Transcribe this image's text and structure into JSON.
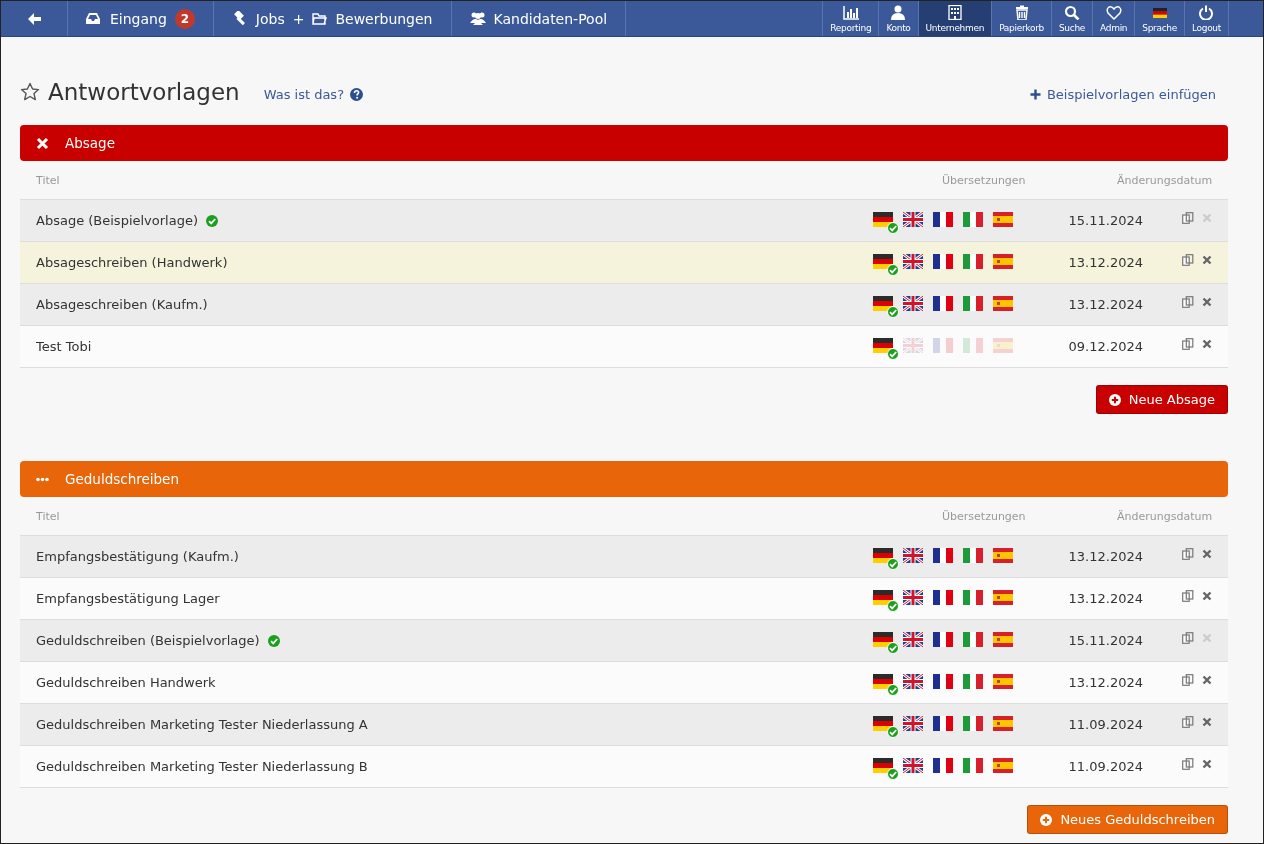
{
  "nav": {
    "left": [
      {
        "kind": "back"
      },
      {
        "kind": "link",
        "label": "Eingang",
        "badge": "2"
      },
      {
        "kind": "pair",
        "label": "Jobs",
        "joiner": "+",
        "label2": "Bewerbungen"
      },
      {
        "kind": "link",
        "label": "Kandidaten-Pool"
      }
    ],
    "right": [
      {
        "label": "Reporting",
        "selected": false
      },
      {
        "label": "Konto",
        "selected": false
      },
      {
        "label": "Unternehmen",
        "selected": true
      },
      {
        "label": "Papierkorb",
        "selected": false
      },
      {
        "label": "Suche",
        "selected": false
      },
      {
        "label": "Admin",
        "selected": false
      },
      {
        "label": "Sprache",
        "selected": false
      },
      {
        "label": "Logout",
        "selected": false
      }
    ]
  },
  "page": {
    "title": "Antwortvorlagen",
    "help_link": "Was ist das?",
    "insert_link": "Beispielvorlagen einfügen"
  },
  "sections": [
    {
      "kind": "absage",
      "title": "Absage",
      "color": "#c90000",
      "columns": [
        "Titel",
        "Übersetzungen",
        "Änderungsdatum"
      ],
      "button": "Neue Absage",
      "rows": [
        {
          "title": "Absage (Beispielvorlage)",
          "example": true,
          "selected": false,
          "date": "15.11.2024",
          "deletable": false,
          "translations": [
            {
              "kind": "de",
              "available": true,
              "checked": true
            },
            {
              "kind": "en",
              "available": true,
              "checked": false
            },
            {
              "kind": "fr",
              "available": true,
              "checked": false
            },
            {
              "kind": "it",
              "available": true,
              "checked": false
            },
            {
              "kind": "es",
              "available": true,
              "checked": false
            }
          ]
        },
        {
          "title": "Absageschreiben (Handwerk)",
          "example": false,
          "selected": true,
          "date": "13.12.2024",
          "deletable": true,
          "translations": [
            {
              "kind": "de",
              "available": true,
              "checked": true
            },
            {
              "kind": "en",
              "available": true,
              "checked": false
            },
            {
              "kind": "fr",
              "available": true,
              "checked": false
            },
            {
              "kind": "it",
              "available": true,
              "checked": false
            },
            {
              "kind": "es",
              "available": true,
              "checked": false
            }
          ]
        },
        {
          "title": "Absageschreiben (Kaufm.)",
          "example": false,
          "selected": false,
          "date": "13.12.2024",
          "deletable": true,
          "translations": [
            {
              "kind": "de",
              "available": true,
              "checked": true
            },
            {
              "kind": "en",
              "available": true,
              "checked": false
            },
            {
              "kind": "fr",
              "available": true,
              "checked": false
            },
            {
              "kind": "it",
              "available": true,
              "checked": false
            },
            {
              "kind": "es",
              "available": true,
              "checked": false
            }
          ]
        },
        {
          "title": "Test Tobi",
          "example": false,
          "selected": false,
          "date": "09.12.2024",
          "deletable": true,
          "translations": [
            {
              "kind": "de",
              "available": true,
              "checked": true
            },
            {
              "kind": "en",
              "available": false,
              "checked": false
            },
            {
              "kind": "fr",
              "available": false,
              "checked": false
            },
            {
              "kind": "it",
              "available": false,
              "checked": false
            },
            {
              "kind": "es",
              "available": false,
              "checked": false
            }
          ]
        }
      ]
    },
    {
      "kind": "geduld",
      "title": "Geduldschreiben",
      "color": "#e8650a",
      "columns": [
        "Titel",
        "Übersetzungen",
        "Änderungsdatum"
      ],
      "button": "Neues Geduldschreiben",
      "rows": [
        {
          "title": "Empfangsbestätigung (Kaufm.)",
          "example": false,
          "selected": false,
          "date": "13.12.2024",
          "deletable": true,
          "translations": [
            {
              "kind": "de",
              "available": true,
              "checked": true
            },
            {
              "kind": "en",
              "available": true,
              "checked": false
            },
            {
              "kind": "fr",
              "available": true,
              "checked": false
            },
            {
              "kind": "it",
              "available": true,
              "checked": false
            },
            {
              "kind": "es",
              "available": true,
              "checked": false
            }
          ]
        },
        {
          "title": "Empfangsbestätigung Lager",
          "example": false,
          "selected": false,
          "date": "13.12.2024",
          "deletable": true,
          "translations": [
            {
              "kind": "de",
              "available": true,
              "checked": true
            },
            {
              "kind": "en",
              "available": true,
              "checked": false
            },
            {
              "kind": "fr",
              "available": true,
              "checked": false
            },
            {
              "kind": "it",
              "available": true,
              "checked": false
            },
            {
              "kind": "es",
              "available": true,
              "checked": false
            }
          ]
        },
        {
          "title": "Geduldschreiben (Beispielvorlage)",
          "example": true,
          "selected": false,
          "date": "15.11.2024",
          "deletable": false,
          "translations": [
            {
              "kind": "de",
              "available": true,
              "checked": true
            },
            {
              "kind": "en",
              "available": true,
              "checked": false
            },
            {
              "kind": "fr",
              "available": true,
              "checked": false
            },
            {
              "kind": "it",
              "available": true,
              "checked": false
            },
            {
              "kind": "es",
              "available": true,
              "checked": false
            }
          ]
        },
        {
          "title": "Geduldschreiben Handwerk",
          "example": false,
          "selected": false,
          "date": "13.12.2024",
          "deletable": true,
          "translations": [
            {
              "kind": "de",
              "available": true,
              "checked": true
            },
            {
              "kind": "en",
              "available": true,
              "checked": false
            },
            {
              "kind": "fr",
              "available": true,
              "checked": false
            },
            {
              "kind": "it",
              "available": true,
              "checked": false
            },
            {
              "kind": "es",
              "available": true,
              "checked": false
            }
          ]
        },
        {
          "title": "Geduldschreiben Marketing Tester Niederlassung A",
          "example": false,
          "selected": false,
          "date": "11.09.2024",
          "deletable": true,
          "translations": [
            {
              "kind": "de",
              "available": true,
              "checked": true
            },
            {
              "kind": "en",
              "available": true,
              "checked": false
            },
            {
              "kind": "fr",
              "available": true,
              "checked": false
            },
            {
              "kind": "it",
              "available": true,
              "checked": false
            },
            {
              "kind": "es",
              "available": true,
              "checked": false
            }
          ]
        },
        {
          "title": "Geduldschreiben Marketing Tester Niederlassung B",
          "example": false,
          "selected": false,
          "date": "11.09.2024",
          "deletable": true,
          "translations": [
            {
              "kind": "de",
              "available": true,
              "checked": true
            },
            {
              "kind": "en",
              "available": true,
              "checked": false
            },
            {
              "kind": "fr",
              "available": true,
              "checked": false
            },
            {
              "kind": "it",
              "available": true,
              "checked": false
            },
            {
              "kind": "es",
              "available": true,
              "checked": false
            }
          ]
        }
      ]
    }
  ]
}
